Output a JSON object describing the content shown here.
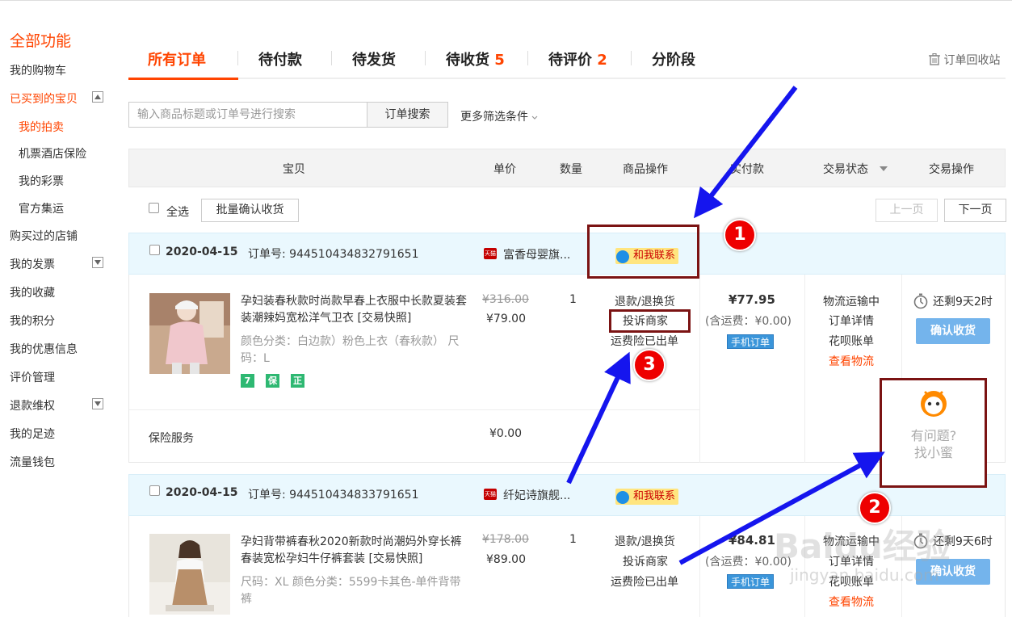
{
  "sidebar": {
    "title": "全部功能",
    "items": [
      {
        "label": "我的购物车"
      },
      {
        "label": "已买到的宝贝"
      },
      {
        "label": "我的拍卖"
      },
      {
        "label": "机票酒店保险"
      },
      {
        "label": "我的彩票"
      },
      {
        "label": "官方集运"
      },
      {
        "label": "购买过的店铺"
      },
      {
        "label": "我的发票"
      },
      {
        "label": "我的收藏"
      },
      {
        "label": "我的积分"
      },
      {
        "label": "我的优惠信息"
      },
      {
        "label": "评价管理"
      },
      {
        "label": "退款维权"
      },
      {
        "label": "我的足迹"
      },
      {
        "label": "流量钱包"
      }
    ]
  },
  "tabs": [
    {
      "label": "所有订单",
      "count": ""
    },
    {
      "label": "待付款",
      "count": ""
    },
    {
      "label": "待发货",
      "count": ""
    },
    {
      "label": "待收货",
      "count": "5"
    },
    {
      "label": "待评价",
      "count": "2"
    },
    {
      "label": "分阶段",
      "count": ""
    }
  ],
  "recycle_label": "订单回收站",
  "search": {
    "placeholder": "输入商品标题或订单号进行搜索",
    "button": "订单搜索",
    "more_filters": "更多筛选条件"
  },
  "table_headers": [
    "宝贝",
    "单价",
    "数量",
    "商品操作",
    "实付款",
    "交易状态",
    "交易操作"
  ],
  "select_all": "全选",
  "batch_confirm": "批量确认收货",
  "pager": {
    "prev": "上一页",
    "next": "下一页"
  },
  "orders": [
    {
      "date": "2020-04-15",
      "order_no": "订单号: 944510434832791651",
      "tmall_tag": "天猫",
      "shop": "富香母婴旗...",
      "contact": "和我联系",
      "title": "孕妇装春秋款时尚款早春上衣服中长款夏装套装潮辣妈宽松洋气卫衣 [交易快照]",
      "attrs": "颜色分类：白边款）粉色上衣（春秋款） 尺码：L",
      "old_price": "¥316.00",
      "price": "¥79.00",
      "qty": "1",
      "ops": [
        "退款/退换货",
        "投诉商家",
        "运费险已出单"
      ],
      "paid": "¥77.95",
      "shipping": "(含运费：¥0.00)",
      "mobile": "手机订单",
      "status": [
        "物流运输中",
        "订单详情",
        "花呗账单",
        "查看物流"
      ],
      "remain": "还剩9天2时",
      "confirm": "确认收货",
      "badges": [
        "7",
        "保",
        "正"
      ],
      "insurance_label": "保险服务",
      "insurance_price": "¥0.00"
    },
    {
      "date": "2020-04-15",
      "order_no": "订单号: 944510434833791651",
      "tmall_tag": "天猫",
      "shop": "纤妃诗旗舰...",
      "contact": "和我联系",
      "title": "孕妇背带裤春秋2020新款时尚潮妈外穿长裤春装宽松孕妇牛仔裤套装 [交易快照]",
      "attrs": "尺码：XL 颜色分类：5599卡其色-单件背带裤",
      "old_price": "¥178.00",
      "price": "¥89.00",
      "qty": "1",
      "ops": [
        "退款/退换货",
        "投诉商家",
        "运费险已出单"
      ],
      "paid": "¥84.81",
      "shipping": "(含运费：¥0.00)",
      "mobile": "手机订单",
      "status": [
        "物流运输中",
        "订单详情",
        "花呗账单",
        "查看物流"
      ],
      "remain": "还剩9天6时",
      "confirm": "确认收货"
    }
  ],
  "help_widget": {
    "line1": "有问题?",
    "line2": "找小蜜"
  },
  "annotations": [
    "1",
    "2",
    "3"
  ],
  "watermark": {
    "logo": "Baidu经验",
    "url": "jingyan.baidu.com"
  },
  "colors": {
    "accent": "#ff4400",
    "annotation_arrow": "#1515ee",
    "annotation_box": "#7b1313",
    "annotation_circle": "#ee0000"
  }
}
